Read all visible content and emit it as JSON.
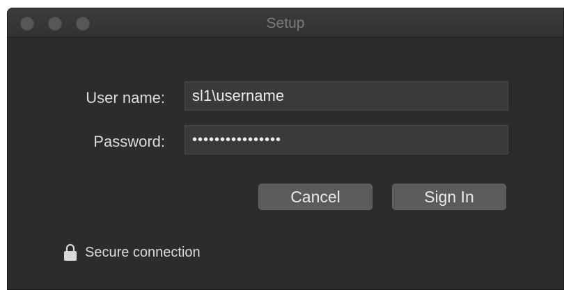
{
  "window": {
    "title": "Setup"
  },
  "form": {
    "username_label": "User name:",
    "username_value": "sl1\\username",
    "password_label": "Password:",
    "password_value": "••••••••••••••••"
  },
  "buttons": {
    "cancel_label": "Cancel",
    "signin_label": "Sign In"
  },
  "footer": {
    "secure_text": "Secure connection",
    "icon": "lock-icon"
  },
  "colors": {
    "window_bg": "#2c2c2c",
    "field_bg": "#3a3a3a",
    "button_bg": "#5b5b5b",
    "text": "#dcdcdc"
  }
}
